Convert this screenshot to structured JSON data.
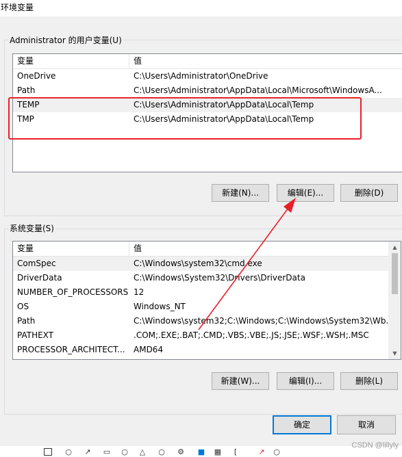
{
  "window": {
    "title": "环境变量"
  },
  "user_vars": {
    "group_label": "Administrator 的用户变量(U)",
    "col_variable": "变量",
    "col_value": "值",
    "rows": [
      {
        "name": "OneDrive",
        "value": "C:\\Users\\Administrator\\OneDrive"
      },
      {
        "name": "Path",
        "value": "C:\\Users\\Administrator\\AppData\\Local\\Microsoft\\WindowsA..."
      },
      {
        "name": "TEMP",
        "value": "C:\\Users\\Administrator\\AppData\\Local\\Temp"
      },
      {
        "name": "TMP",
        "value": "C:\\Users\\Administrator\\AppData\\Local\\Temp"
      }
    ],
    "selected_row": "TEMP",
    "buttons": {
      "new": "新建(N)...",
      "edit": "编辑(E)...",
      "delete": "删除(D)"
    }
  },
  "system_vars": {
    "group_label": "系统变量(S)",
    "col_variable": "变量",
    "col_value": "值",
    "rows": [
      {
        "name": "ComSpec",
        "value": "C:\\Windows\\system32\\cmd.exe"
      },
      {
        "name": "DriverData",
        "value": "C:\\Windows\\System32\\Drivers\\DriverData"
      },
      {
        "name": "NUMBER_OF_PROCESSORS",
        "value": "12"
      },
      {
        "name": "OS",
        "value": "Windows_NT"
      },
      {
        "name": "Path",
        "value": "C:\\Windows\\system32;C:\\Windows;C:\\Windows\\System32\\Wb..."
      },
      {
        "name": "PATHEXT",
        "value": ".COM;.EXE;.BAT;.CMD;.VBS;.VBE;.JS;.JSE;.WSF;.WSH;.MSC"
      },
      {
        "name": "PROCESSOR_ARCHITECT...",
        "value": "AMD64"
      }
    ],
    "selected_row": "ComSpec",
    "buttons": {
      "new": "新建(W)...",
      "edit": "编辑(I)...",
      "delete": "删除(L)"
    }
  },
  "footer": {
    "ok": "确定",
    "cancel": "取消"
  },
  "annotation": {
    "box_color": "#e8202a",
    "arrow_color": "#e8202a"
  },
  "watermark": "CSDN @lillyly",
  "colors": {
    "dialog_bg": "#f0f0f0",
    "default_button_border": "#0078d7"
  }
}
